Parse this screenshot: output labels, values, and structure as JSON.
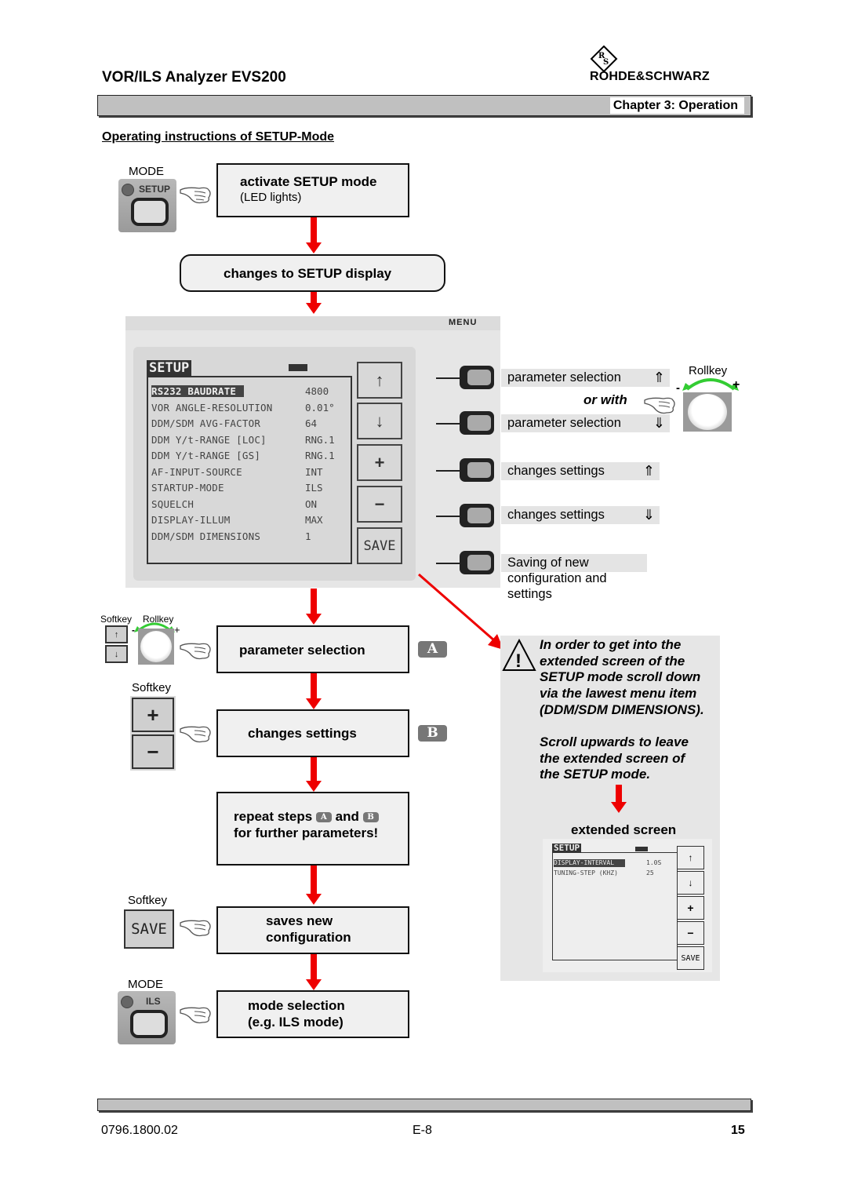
{
  "header": {
    "doc_title": "VOR/ILS Analyzer EVS200",
    "brand": "ROHDE&SCHWARZ",
    "brand_logo_icon": "rs-diamond-logo",
    "chapter": "Chapter 3: Operation",
    "section_title": "Operating instructions of SETUP-Mode"
  },
  "flow": {
    "step1": {
      "key_caption": "MODE",
      "key_label": "SETUP",
      "title": "activate SETUP mode",
      "subtitle": "(LED lights)"
    },
    "step2": {
      "title": "changes to SETUP display"
    },
    "step3": {
      "softkey_caption": "Softkey",
      "rollkey_caption": "Rollkey",
      "minus": "-",
      "plus": "+",
      "title": "parameter selection",
      "badge": "A"
    },
    "step4": {
      "softkey_caption": "Softkey",
      "plus_key": "+",
      "minus_key": "−",
      "title": "changes settings",
      "badge": "B"
    },
    "step5": {
      "line1_pre": "repeat steps",
      "badge_a": "A",
      "and": "and",
      "badge_b": "B",
      "line2": "for further parameters!"
    },
    "step6": {
      "softkey_caption": "Softkey",
      "save_key": "SAVE",
      "line1": "saves new",
      "line2": "configuration"
    },
    "step7": {
      "key_caption": "MODE",
      "key_label": "ILS",
      "line1": "mode selection",
      "line2": "(e.g. ILS mode)"
    }
  },
  "device": {
    "menu_label": "MENU",
    "screen_title": "SETUP",
    "rows": [
      {
        "name": "RS232 BAUDRATE",
        "value": "4800",
        "selected": true
      },
      {
        "name": "VOR ANGLE-RESOLUTION",
        "value": "0.01°"
      },
      {
        "name": "DDM/SDM AVG-FACTOR",
        "value": "64"
      },
      {
        "name": "DDM Y/t-RANGE [LOC]",
        "value": "RNG.1"
      },
      {
        "name": "DDM Y/t-RANGE [GS]",
        "value": "RNG.1"
      },
      {
        "name": "AF-INPUT-SOURCE",
        "value": "INT"
      },
      {
        "name": "STARTUP-MODE",
        "value": "ILS"
      },
      {
        "name": "SQUELCH",
        "value": "ON"
      },
      {
        "name": "DISPLAY-ILLUM",
        "value": "MAX"
      },
      {
        "name": "DDM/SDM DIMENSIONS",
        "value": "1"
      }
    ],
    "softkeys": [
      "↑",
      "↓",
      "+",
      "−",
      "SAVE"
    ]
  },
  "descriptions": {
    "param_up": "parameter selection",
    "or_with": "or with",
    "param_down": "parameter selection",
    "change_up": "changes settings",
    "change_down": "changes settings",
    "save_line1": "Saving of new",
    "save_line2": "configuration and",
    "save_line3": "settings",
    "arrow_up": "⇑",
    "arrow_down": "⇓",
    "rollkey_caption": "Rollkey",
    "minus": "-",
    "plus": "+"
  },
  "note": {
    "warning_icon": "warning-triangle",
    "lines_a": [
      "In order to get into the",
      "extended screen of the",
      "SETUP mode scroll down",
      "via the lawest menu item",
      "(DDM/SDM DIMENSIONS)."
    ],
    "lines_b": [
      "Scroll upwards to leave",
      "the extended screen of",
      "the SETUP mode."
    ],
    "extended_caption": "extended screen",
    "ext_screen": {
      "title": "SETUP",
      "rows": [
        {
          "name": "DISPLAY-INTERVAL",
          "value": "1.0S",
          "selected": true
        },
        {
          "name": "TUNING-STEP (KHZ)",
          "value": "25"
        }
      ],
      "softkeys": [
        "↑",
        "↓",
        "+",
        "−",
        "SAVE"
      ]
    }
  },
  "footer": {
    "doc_number": "0796.1800.02",
    "page_code": "E-8",
    "page_number": "15"
  },
  "colors": {
    "arrow_red": "#ee0000",
    "rollkey_green": "#33cc33",
    "bar_gray": "#c0c0c0",
    "box_fill": "#f0f0f0"
  }
}
